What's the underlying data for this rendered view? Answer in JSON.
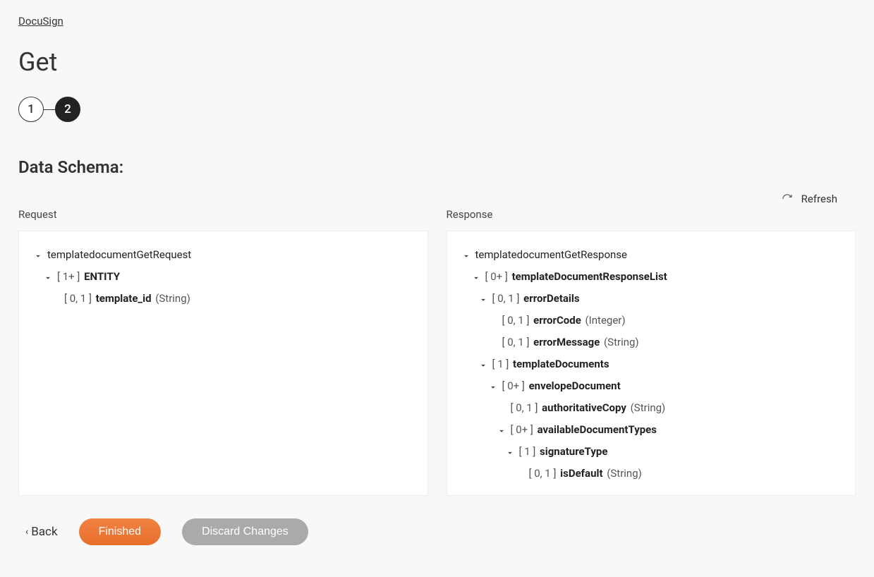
{
  "breadcrumb": "DocuSign",
  "pageTitle": "Get",
  "stepper": {
    "step1": "1",
    "step2": "2"
  },
  "sectionHeading": "Data Schema:",
  "refresh": "Refresh",
  "columns": {
    "request": "Request",
    "response": "Response"
  },
  "requestTree": [
    {
      "indent": 0,
      "chev": true,
      "card": "",
      "name": "templatedocumentGetRequest",
      "bold": false,
      "type": ""
    },
    {
      "indent": 1,
      "chev": true,
      "card": "[ 1+ ]",
      "name": "ENTITY",
      "bold": true,
      "type": ""
    },
    {
      "indent": 2,
      "chev": false,
      "card": "[ 0, 1 ]",
      "name": "template_id",
      "bold": true,
      "type": "(String)"
    }
  ],
  "responseTree": [
    {
      "indent": 0,
      "chev": true,
      "card": "",
      "name": "templatedocumentGetResponse",
      "bold": false,
      "type": ""
    },
    {
      "indent": 1,
      "chev": true,
      "card": "[ 0+ ]",
      "name": "templateDocumentResponseList",
      "bold": true,
      "type": ""
    },
    {
      "indent": 2,
      "chev": true,
      "card": "[ 0, 1 ]",
      "name": "errorDetails",
      "bold": true,
      "type": ""
    },
    {
      "indent": 3,
      "chev": false,
      "card": "[ 0, 1 ]",
      "name": "errorCode",
      "bold": true,
      "type": "(Integer)"
    },
    {
      "indent": 3,
      "chev": false,
      "card": "[ 0, 1 ]",
      "name": "errorMessage",
      "bold": true,
      "type": "(String)"
    },
    {
      "indent": 2,
      "chev": true,
      "card": "[ 1 ]",
      "name": "templateDocuments",
      "bold": true,
      "type": ""
    },
    {
      "indent": 3,
      "chev": true,
      "card": "[ 0+ ]",
      "name": "envelopeDocument",
      "bold": true,
      "type": ""
    },
    {
      "indent": 4,
      "chev": false,
      "card": "[ 0, 1 ]",
      "name": "authoritativeCopy",
      "bold": true,
      "type": "(String)"
    },
    {
      "indent": 4,
      "chev": true,
      "card": "[ 0+ ]",
      "name": "availableDocumentTypes",
      "bold": true,
      "type": ""
    },
    {
      "indent": 5,
      "chev": true,
      "card": "[ 1 ]",
      "name": "signatureType",
      "bold": true,
      "type": ""
    },
    {
      "indent": 6,
      "chev": false,
      "card": "[ 0, 1 ]",
      "name": "isDefault",
      "bold": true,
      "type": "(String)"
    }
  ],
  "footer": {
    "back": "Back",
    "finished": "Finished",
    "discard": "Discard Changes"
  }
}
